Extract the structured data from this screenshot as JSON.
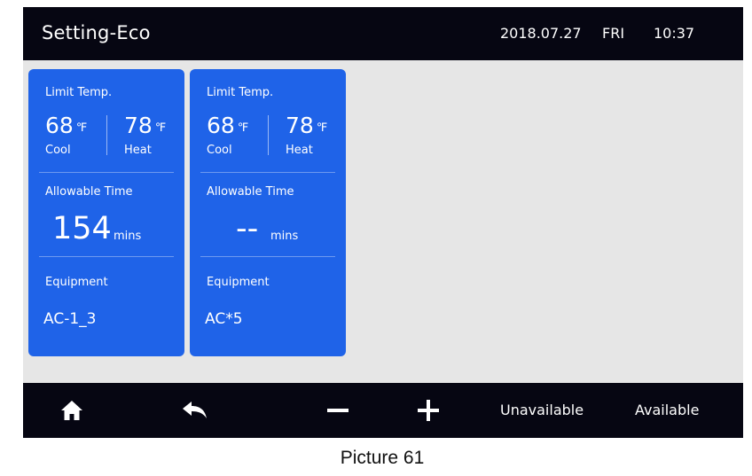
{
  "header": {
    "title": "Setting-Eco",
    "date": "2018.07.27",
    "day": "FRI",
    "time": "10:37"
  },
  "cards": [
    {
      "limit_label": "Limit Temp.",
      "cool_value": "68",
      "cool_unit": "℉",
      "cool_label": "Cool",
      "heat_value": "78",
      "heat_unit": "℉",
      "heat_label": "Heat",
      "time_label": "Allowable Time",
      "time_value": "154",
      "time_unit": "mins",
      "equipment_label": "Equipment",
      "equipment_value": "AC-1_3"
    },
    {
      "limit_label": "Limit Temp.",
      "cool_value": "68",
      "cool_unit": "℉",
      "cool_label": "Cool",
      "heat_value": "78",
      "heat_unit": "℉",
      "heat_label": "Heat",
      "time_label": "Allowable Time",
      "time_value": "--",
      "time_unit": "mins",
      "equipment_label": "Equipment",
      "equipment_value": "AC*5"
    }
  ],
  "footer": {
    "home_icon": "home-icon",
    "back_icon": "back-arrow-icon",
    "minus_icon": "minus-icon",
    "plus_icon": "plus-icon",
    "unavailable_label": "Unavailable",
    "available_label": "Available"
  },
  "caption": "Picture 61",
  "colors": {
    "bar_background": "#060612",
    "card_background": "#1f63e8",
    "screen_background": "#e6e6e6"
  }
}
